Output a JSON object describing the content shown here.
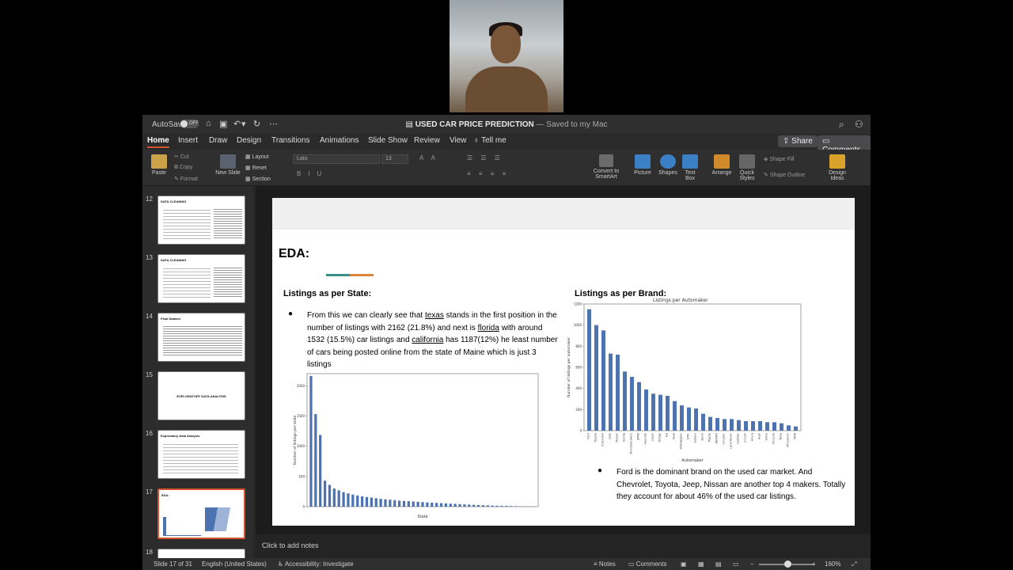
{
  "app": {
    "autosave_label": "AutoSave",
    "autosave_state": "OFF",
    "doc_title": "USED CAR PRICE PREDICTION",
    "doc_subtitle": "— Saved to my Mac"
  },
  "tabs": [
    "Home",
    "Insert",
    "Draw",
    "Design",
    "Transitions",
    "Animations",
    "Slide Show",
    "Review",
    "View",
    "Tell me"
  ],
  "share_label": "Share",
  "comments_label": "Comments",
  "ribbon": {
    "paste": "Paste",
    "cut": "Cut",
    "copy": "Copy",
    "format": "Format",
    "new_slide": "New Slide",
    "layout": "Layout",
    "reset": "Reset",
    "section": "Section",
    "font": "Lato",
    "font_size": "13",
    "convert": "Convert to SmartArt",
    "picture": "Picture",
    "shapes": "Shapes",
    "text_box": "Text Box",
    "arrange": "Arrange",
    "quick_styles": "Quick Styles",
    "shape_fill": "Shape Fill",
    "shape_outline": "Shape Outline",
    "design_ideas": "Design Ideas"
  },
  "thumbnails": [
    {
      "num": "12",
      "title": "DATA CLEANING",
      "kind": "text-table"
    },
    {
      "num": "13",
      "title": "DATA CLEANING",
      "kind": "text-table"
    },
    {
      "num": "14",
      "title": "Final Dataset",
      "kind": "table"
    },
    {
      "num": "15",
      "title": "EXPLORATORY DATA ANALYSIS",
      "kind": "center"
    },
    {
      "num": "16",
      "title": "Exploratory Data Analysis",
      "kind": "text"
    },
    {
      "num": "17",
      "title": "EDA:",
      "kind": "selected"
    },
    {
      "num": "18",
      "title": "",
      "kind": "partial"
    }
  ],
  "slide": {
    "title": "EDA:",
    "left_heading": "Listings as per State:",
    "right_heading": "Listings as per Brand:",
    "left_bullet": "●",
    "left_text_1": "From this we can clearly see that ",
    "left_text_texas": "texas",
    "left_text_2": " stands in the first position in the number of listings with 2162 (21.8%) and next is ",
    "left_text_florida": "florida",
    "left_text_3": " with around 1532 (15.5%) car listings and ",
    "left_text_california": "california",
    "left_text_4": " has 1187(12%) he least number of cars being posted online from the state of Maine which is just 3 listings",
    "right_bullet": "●",
    "right_text": "Ford is the dominant brand on the used car market. And Chevrolet, Toyota, Jeep, Nissan are another top 4 makers. Totally they account for about 46% of the used car listings."
  },
  "notes_placeholder": "Click to add notes",
  "status": {
    "slide_info": "Slide 17 of 31",
    "language": "English (United States)",
    "accessibility": "Accessibility: Investigate",
    "notes": "Notes",
    "comments": "Comments",
    "zoom": "160%"
  },
  "colors": {
    "bar": "#4c72b0",
    "accent": "#d35230"
  },
  "chart_data": [
    {
      "type": "bar",
      "title": "",
      "xlabel": "State",
      "ylabel": "Number of listings per state",
      "ylim": [
        0,
        2200
      ],
      "yticks": [
        0,
        500,
        1000,
        1500,
        2000
      ],
      "values": [
        2162,
        1532,
        1187,
        430,
        360,
        300,
        270,
        240,
        220,
        200,
        185,
        170,
        160,
        150,
        140,
        130,
        122,
        115,
        108,
        100,
        95,
        90,
        85,
        80,
        75,
        70,
        66,
        62,
        58,
        54,
        50,
        46,
        42,
        38,
        34,
        30,
        27,
        24,
        21,
        18,
        16,
        14,
        12,
        10,
        8,
        6,
        5,
        4,
        3
      ]
    },
    {
      "type": "bar",
      "title": "Listings per Automaker",
      "xlabel": "Automaker",
      "ylabel": "Number of listings per automaker",
      "ylim": [
        0,
        1200
      ],
      "yticks": [
        0,
        200,
        400,
        600,
        800,
        1000,
        1200
      ],
      "categories": [
        "Ford",
        "Toyota",
        "Chevrolet",
        "Jeep",
        "Nissan",
        "Honda",
        "Mercedes-Benz",
        "BMW",
        "Hyundai",
        "Lexus",
        "Dodge",
        "Kia",
        "Ram",
        "Volkswagen",
        "GMC",
        "Subaru",
        "Buick",
        "Mazda",
        "INFINITI",
        "Chrysler",
        "Land Rover",
        "Cadillac",
        "Lincoln",
        "Acura",
        "Audi",
        "Volvo",
        "Porsche",
        "Tesla",
        "Mitsubishi",
        "MINI"
      ],
      "values": [
        1150,
        1000,
        950,
        730,
        720,
        560,
        510,
        460,
        390,
        350,
        340,
        330,
        280,
        240,
        220,
        210,
        160,
        130,
        120,
        110,
        110,
        100,
        90,
        90,
        90,
        80,
        80,
        70,
        50,
        40
      ]
    }
  ]
}
